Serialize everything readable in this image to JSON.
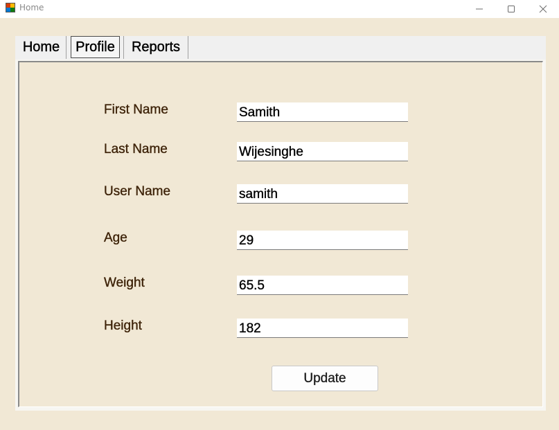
{
  "window": {
    "title": "Home",
    "minimize_icon": "minimize-icon",
    "maximize_icon": "maximize-icon",
    "close_icon": "close-icon",
    "app_icon": "windows-forms-app-icon"
  },
  "tabs": [
    {
      "label": "Home",
      "selected": false
    },
    {
      "label": "Profile",
      "selected": true
    },
    {
      "label": "Reports",
      "selected": false
    }
  ],
  "profile": {
    "fields": [
      {
        "label": "First Name",
        "value": "Samith"
      },
      {
        "label": "Last Name",
        "value": "Wijesinghe"
      },
      {
        "label": "User Name",
        "value": "samith"
      },
      {
        "label": "Age",
        "value": "29"
      },
      {
        "label": "Weight",
        "value": "65.5"
      },
      {
        "label": "Height",
        "value": "182"
      }
    ],
    "update_label": "Update"
  },
  "colors": {
    "background": "#f1e8d5",
    "label_text": "#3d2208"
  }
}
